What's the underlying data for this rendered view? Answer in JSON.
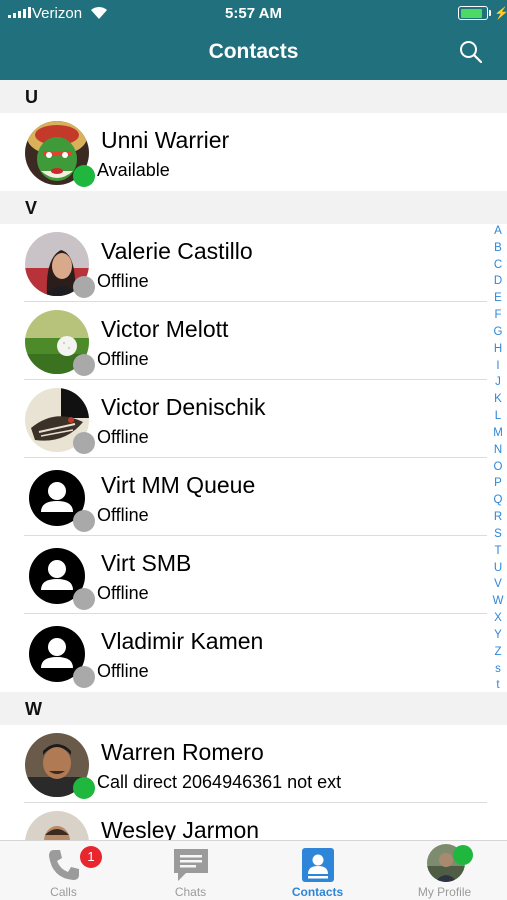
{
  "status_bar": {
    "carrier": "Verizon",
    "time": "5:57 AM",
    "battery_percent": 0.85
  },
  "header": {
    "title": "Contacts",
    "search_icon": "search-icon"
  },
  "colors": {
    "header": "#20707d",
    "accent": "#2f86d8",
    "available": "#1fb73e",
    "offline": "#a9a9a9",
    "badge": "#e8262e"
  },
  "sections": [
    {
      "letter": "U",
      "contacts": [
        {
          "name": "Unni Warrier",
          "status": "Available",
          "presence": "available",
          "avatar": "kathakali-photo"
        }
      ]
    },
    {
      "letter": "V",
      "contacts": [
        {
          "name": "Valerie Castillo",
          "status": "Offline",
          "presence": "offline",
          "avatar": "portrait-photo"
        },
        {
          "name": "Victor Melott",
          "status": "Offline",
          "presence": "offline",
          "avatar": "golf-ball-photo"
        },
        {
          "name": "Victor Denischik",
          "status": "Offline",
          "presence": "offline",
          "avatar": "bird-photo"
        },
        {
          "name": "Virt MM Queue",
          "status": "Offline",
          "presence": "offline",
          "avatar": "default-person-icon"
        },
        {
          "name": "Virt SMB",
          "status": "Offline",
          "presence": "offline",
          "avatar": "default-person-icon"
        },
        {
          "name": "Vladimir Kamen",
          "status": "Offline",
          "presence": "offline",
          "avatar": "default-person-icon"
        }
      ]
    },
    {
      "letter": "W",
      "contacts": [
        {
          "name": "Warren Romero",
          "status": "Call direct 2064946361 not ext",
          "presence": "available",
          "avatar": "selfie-photo"
        },
        {
          "name": "Wesley Jarmon",
          "status": "",
          "presence": "",
          "avatar": "portrait-photo"
        }
      ]
    }
  ],
  "index_letters": [
    "A",
    "B",
    "C",
    "D",
    "E",
    "F",
    "G",
    "H",
    "I",
    "J",
    "K",
    "L",
    "M",
    "N",
    "O",
    "P",
    "Q",
    "R",
    "S",
    "T",
    "U",
    "V",
    "W",
    "X",
    "Y",
    "Z",
    "s",
    "t"
  ],
  "tabs": [
    {
      "label": "Calls",
      "icon": "phone-icon",
      "badge": "1",
      "active": false
    },
    {
      "label": "Chats",
      "icon": "chat-bubble-icon",
      "active": false
    },
    {
      "label": "Contacts",
      "icon": "contact-card-icon",
      "active": true
    },
    {
      "label": "My Profile",
      "icon": "profile-avatar",
      "active": false
    }
  ]
}
